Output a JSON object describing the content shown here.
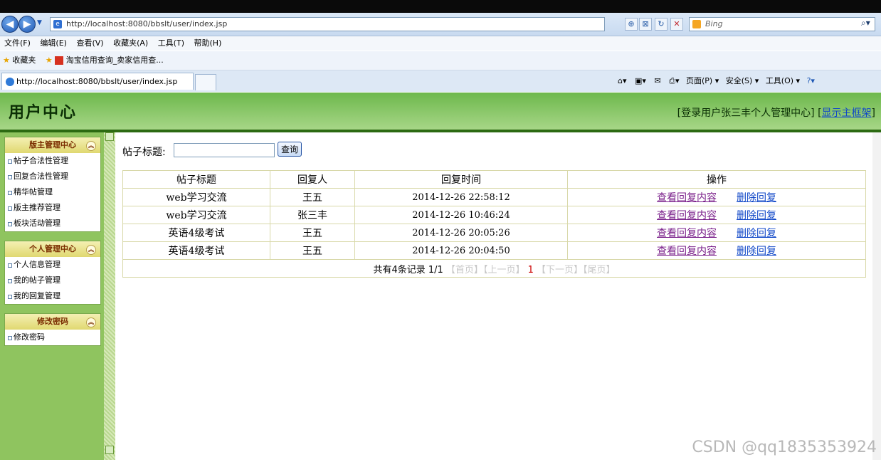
{
  "browser": {
    "url": "http://localhost:8080/bbslt/user/index.jsp",
    "search_engine": "Bing",
    "menu": [
      "文件(F)",
      "编辑(E)",
      "查看(V)",
      "收藏夹(A)",
      "工具(T)",
      "帮助(H)"
    ],
    "favorites_label": "收藏夹",
    "favorite_link": "淘宝信用查询_卖家信用查...",
    "tab_title": "http://localhost:8080/bbslt/user/index.jsp",
    "cmd_page": "页面(P) ▾",
    "cmd_safety": "安全(S) ▾",
    "cmd_tools": "工具(O) ▾"
  },
  "header": {
    "title": "用户中心",
    "login_info": "[登录用户张三丰个人管理中心]",
    "show_frame_link": "显示主框架",
    "bracket_open": "[",
    "bracket_close": "]"
  },
  "sidebar": {
    "panels": [
      {
        "title": "版主管理中心",
        "items": [
          "帖子合法性管理",
          "回复合法性管理",
          "精华帖管理",
          "版主推荐管理",
          "板块活动管理"
        ]
      },
      {
        "title": "个人管理中心",
        "items": [
          "个人信息管理",
          "我的帖子管理",
          "我的回复管理"
        ]
      },
      {
        "title": "修改密码",
        "items": [
          "修改密码"
        ]
      }
    ]
  },
  "search": {
    "label": "帖子标题:",
    "value": "",
    "button": "查询"
  },
  "table": {
    "headers": [
      "帖子标题",
      "回复人",
      "回复时间",
      "操作"
    ],
    "rows": [
      {
        "title": "web学习交流",
        "replier": "王五",
        "time": "2014-12-26 22:58:12",
        "view": "查看回复内容",
        "delete": "删除回复"
      },
      {
        "title": "web学习交流",
        "replier": "张三丰",
        "time": "2014-12-26 10:46:24",
        "view": "查看回复内容",
        "delete": "删除回复"
      },
      {
        "title": "英语4级考试",
        "replier": "王五",
        "time": "2014-12-26 20:05:26",
        "view": "查看回复内容",
        "delete": "删除回复"
      },
      {
        "title": "英语4级考试",
        "replier": "王五",
        "time": "2014-12-26 20:04:50",
        "view": "查看回复内容",
        "delete": "删除回复"
      }
    ],
    "pager": {
      "summary": "共有4条记录",
      "page_info": "1/1",
      "first": "【首页】",
      "prev": "【上一页】",
      "current": "1",
      "next": "【下一页】",
      "last": "【尾页】"
    }
  },
  "watermark": "CSDN @qq1835353924",
  "colors": {
    "header_green": "#6db84c",
    "sidebar_green": "#8fc45f",
    "link_blue": "#1148c8",
    "visited_purple": "#7a1f8a",
    "page_current_red": "#cc0000"
  }
}
